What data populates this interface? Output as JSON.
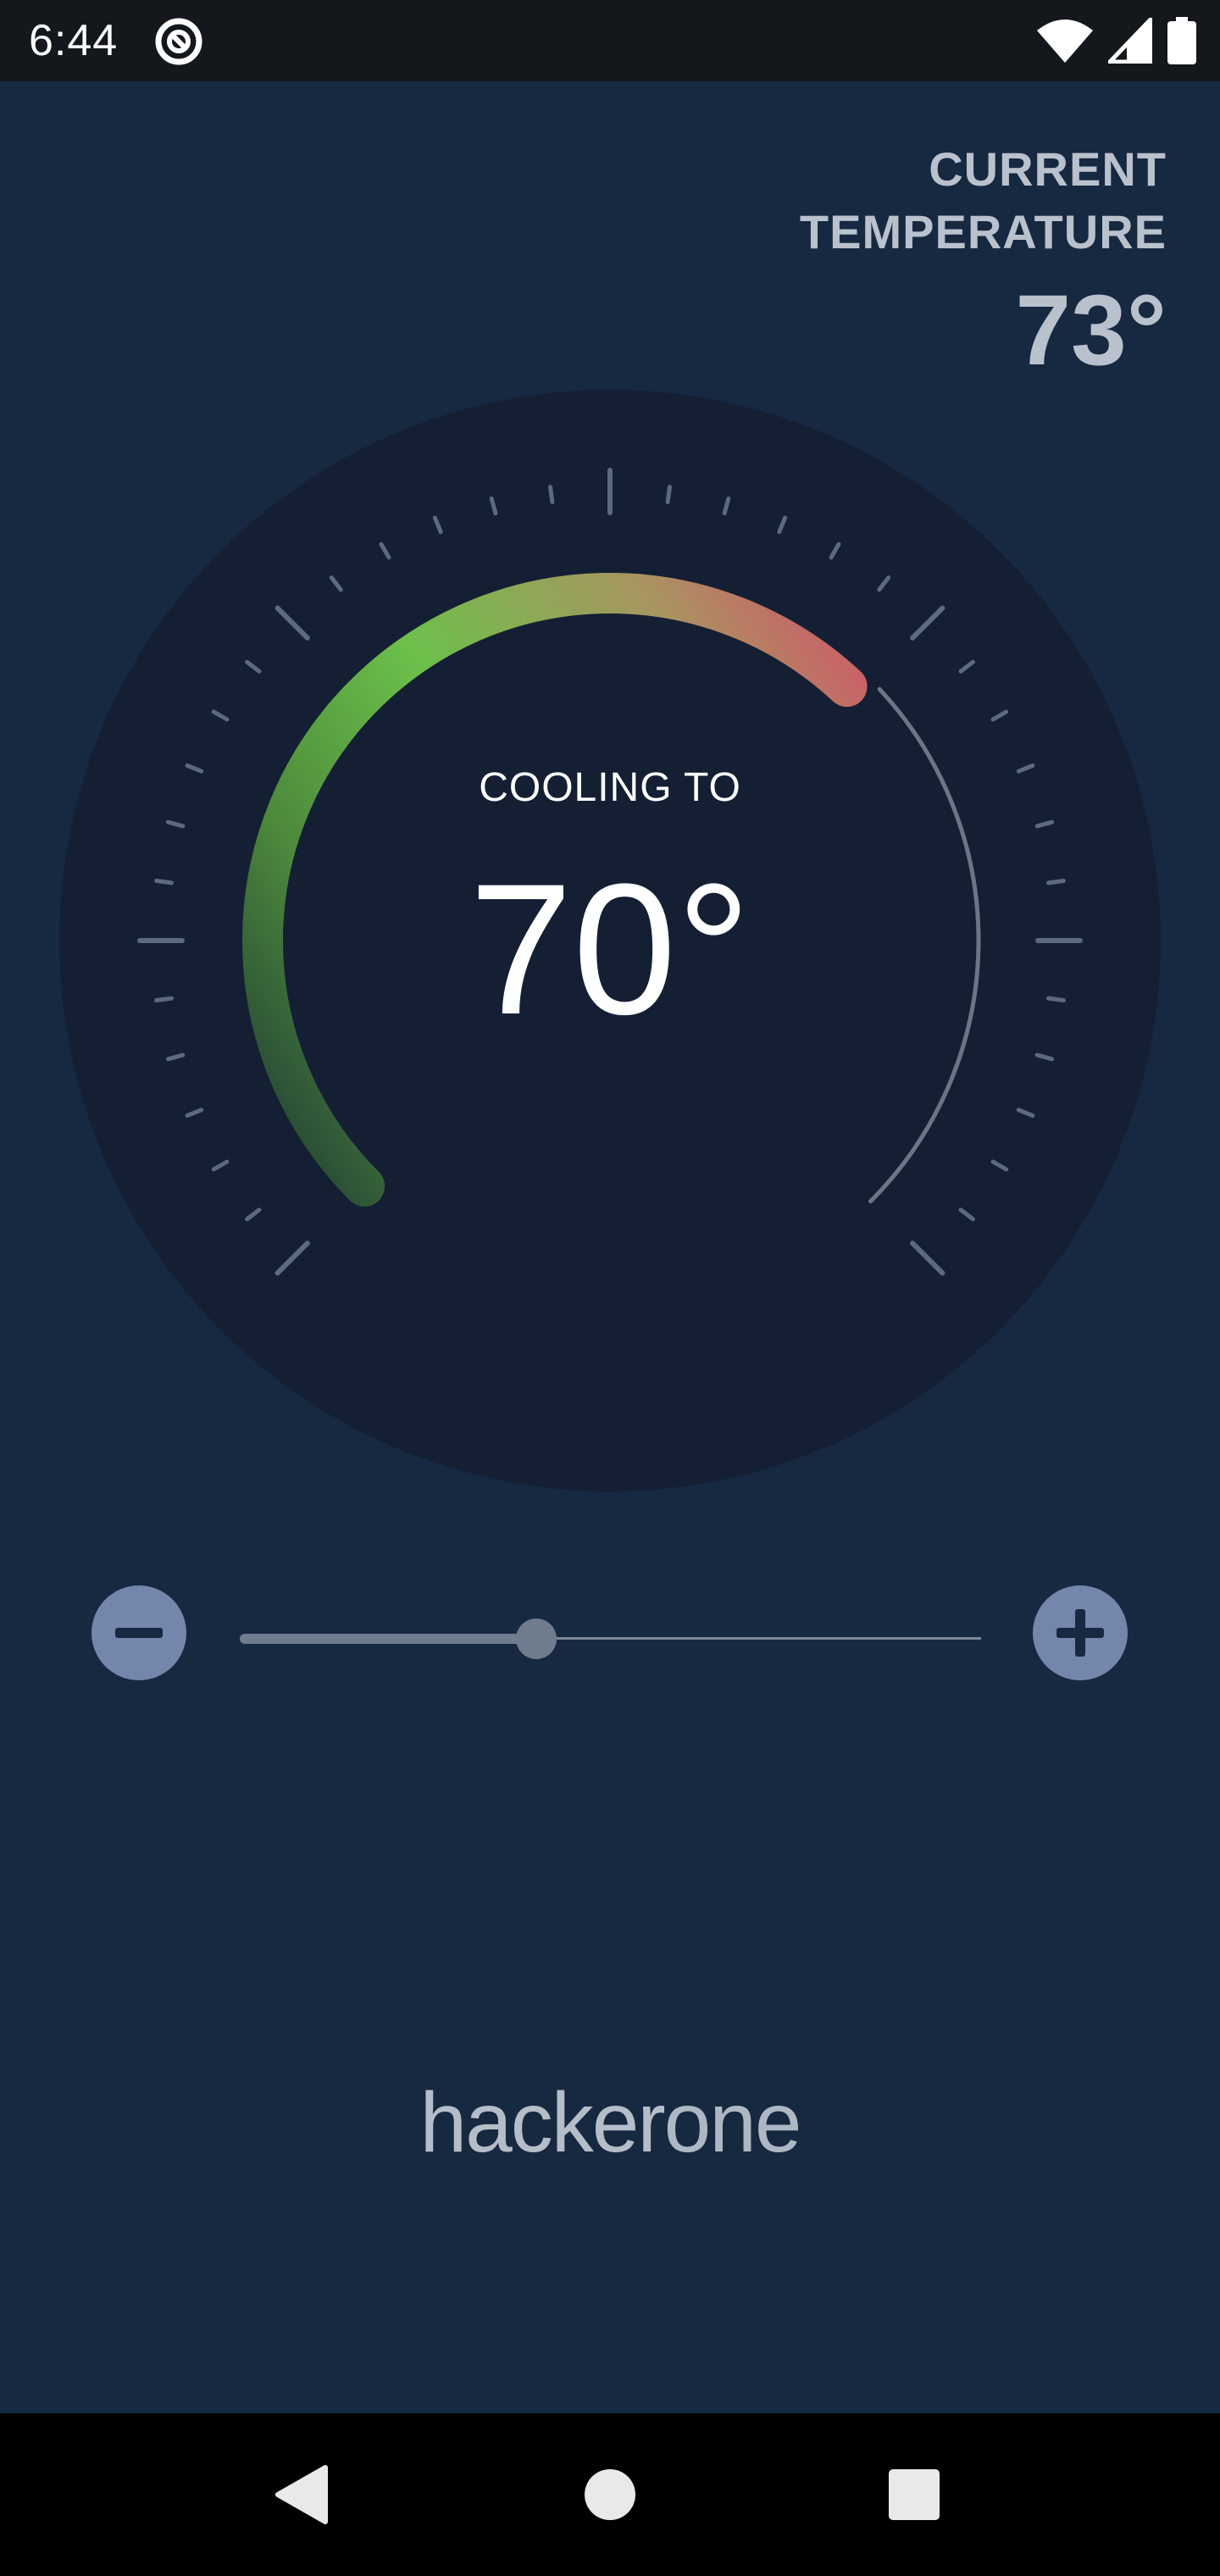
{
  "status_bar": {
    "time": "6:44",
    "icons": [
      "app-notification-icon",
      "wifi-icon",
      "cell-signal-icon",
      "battery-icon"
    ]
  },
  "current_temperature": {
    "label": "CURRENT TEMPERATURE",
    "value": "73°"
  },
  "thermostat": {
    "mode_label": "COOLING TO",
    "setpoint": "70°",
    "gauge_colors": {
      "start": "#2f5b3a",
      "mid": "#6cc04a",
      "end": "#d4506a"
    }
  },
  "controls": {
    "decrease_icon": "minus-icon",
    "increase_icon": "plus-icon",
    "slider_value_percent": 40
  },
  "brand": {
    "part1": "hacker",
    "part2": "one"
  },
  "nav_bar": {
    "icons": [
      "back-icon",
      "home-icon",
      "recents-icon"
    ]
  },
  "colors": {
    "background": "#172841",
    "dial": "#141f33",
    "button": "#7486ab"
  }
}
